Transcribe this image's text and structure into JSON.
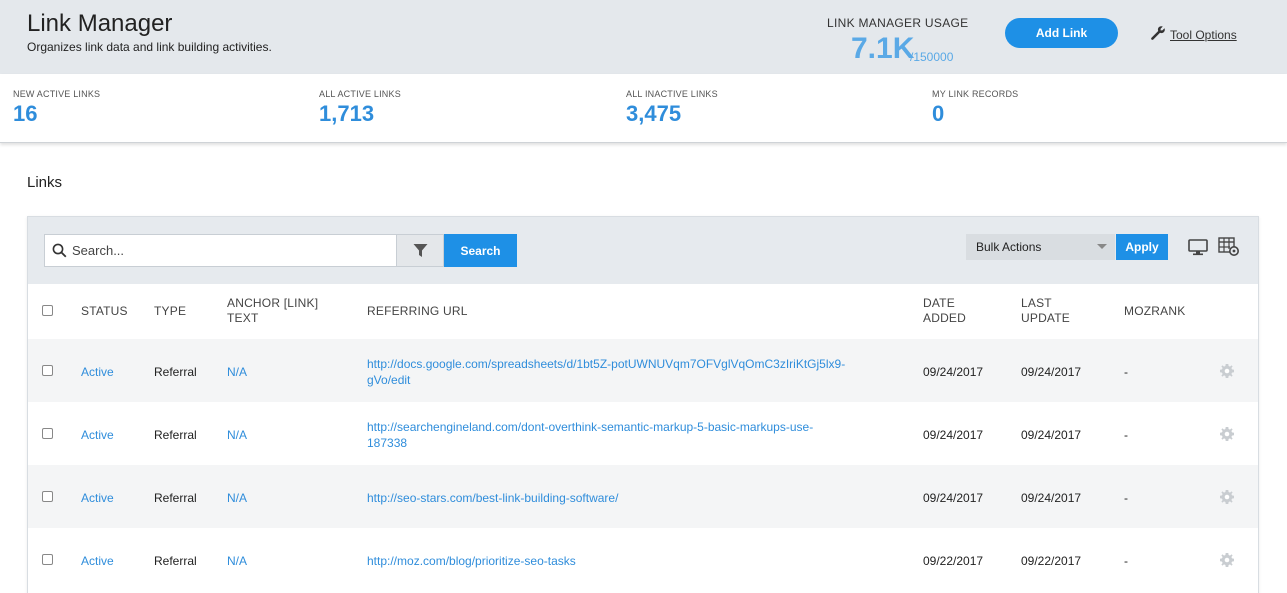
{
  "header": {
    "title": "Link Manager",
    "subtitle": "Organizes link data and link building activities.",
    "usage_label": "LINK MANAGER USAGE",
    "usage_value": "7.1K",
    "usage_total": "/150000",
    "add_link_label": "Add Link",
    "tool_options_label": "Tool Options"
  },
  "stats": [
    {
      "label": "NEW ACTIVE LINKS",
      "value": "16"
    },
    {
      "label": "ALL ACTIVE LINKS",
      "value": "1,713"
    },
    {
      "label": "ALL INACTIVE LINKS",
      "value": "3,475"
    },
    {
      "label": "MY LINK RECORDS",
      "value": "0"
    }
  ],
  "section_title": "Links",
  "toolbar": {
    "search_placeholder": "Search...",
    "search_button": "Search",
    "bulk_actions": "Bulk Actions",
    "apply_button": "Apply"
  },
  "columns": {
    "status": "STATUS",
    "type": "TYPE",
    "anchor_line1": "ANCHOR [LINK]",
    "anchor_line2": "TEXT",
    "referring_url": "REFERRING URL",
    "date_added_line1": "DATE",
    "date_added_line2": "ADDED",
    "last_update_line1": "LAST",
    "last_update_line2": "UPDATE",
    "mozrank": "MOZRANK"
  },
  "rows": [
    {
      "status": "Active",
      "type": "Referral",
      "anchor": "N/A",
      "url_line1": "http://docs.google.com/spreadsheets/d/1bt5Z-potUWNUVqm7OFVglVqOmC3zIriKtGj5lx9-",
      "url_line2": "gVo/edit",
      "date_added": "09/24/2017",
      "last_update": "09/24/2017",
      "mozrank": "-"
    },
    {
      "status": "Active",
      "type": "Referral",
      "anchor": "N/A",
      "url_line1": "http://searchengineland.com/dont-overthink-semantic-markup-5-basic-markups-use-",
      "url_line2": "187338",
      "date_added": "09/24/2017",
      "last_update": "09/24/2017",
      "mozrank": "-"
    },
    {
      "status": "Active",
      "type": "Referral",
      "anchor": "N/A",
      "url_line1": "http://seo-stars.com/best-link-building-software/",
      "url_line2": "",
      "date_added": "09/24/2017",
      "last_update": "09/24/2017",
      "mozrank": "-"
    },
    {
      "status": "Active",
      "type": "Referral",
      "anchor": "N/A",
      "url_line1": "http://moz.com/blog/prioritize-seo-tasks",
      "url_line2": "",
      "date_added": "09/22/2017",
      "last_update": "09/22/2017",
      "mozrank": "-"
    }
  ],
  "colors": {
    "accent": "#1e90e6",
    "link": "#2f8ddb",
    "header_bg": "#e4e8ec"
  }
}
